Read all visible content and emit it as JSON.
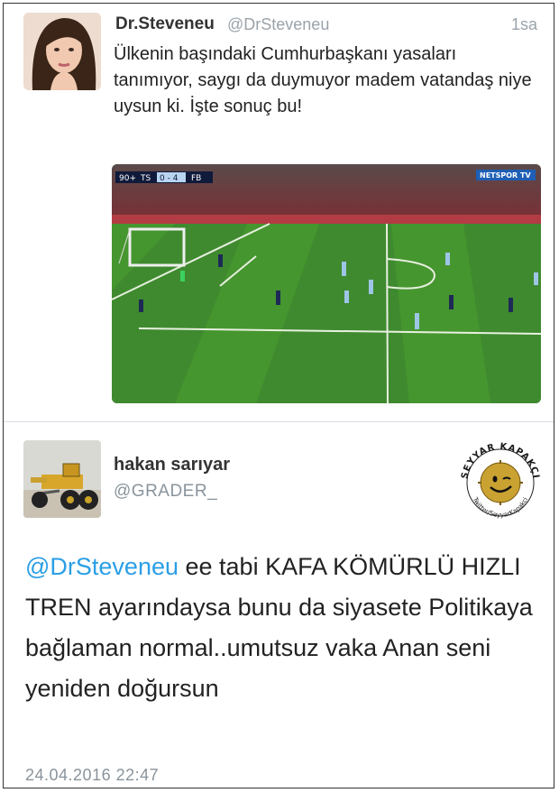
{
  "tweet1": {
    "name": "Dr.Steveneu",
    "handle": "@DrSteveneu",
    "time": "1sa",
    "text": "Ülkenin başındaki Cumhurbaşkanı yasaları tanımıyor, saygı da duymuyor madem vatandaş niye uysun ki. İşte sonuç bu!",
    "video": {
      "clock": "90+",
      "home": "TS",
      "score": "0 - 4",
      "away": "FB",
      "channel": "NETSPOR TV"
    }
  },
  "tweet2": {
    "name": "hakan sarıyar",
    "handle": "@GRADER_",
    "mention": "@DrSteveneu",
    "text": " ee tabi KAFA KÖMÜRLÜ HIZLI TREN ayarındaysa bunu da siyasete Politikaya bağlaman normal..umutsuz vaka Anan seni yeniden doğursun",
    "date": "24.04.2016 22:47"
  },
  "watermark": {
    "top_text": "SEYYAR KAPAKÇI",
    "bottom_text": "Twitter/SeyyarKapakci"
  },
  "colors": {
    "link": "#2b9fe6",
    "muted": "#9aa3ab"
  }
}
